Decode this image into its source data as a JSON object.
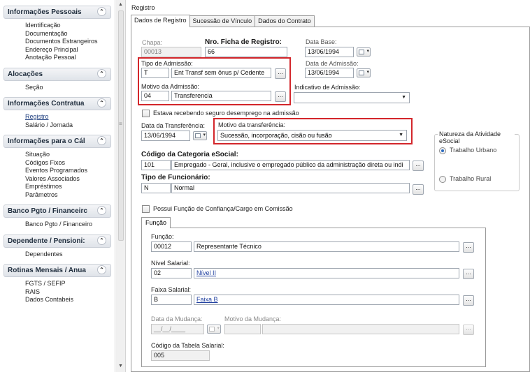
{
  "sidebar": {
    "sections": [
      {
        "title": "Informações Pessoais",
        "items": [
          "Identificação",
          "Documentação",
          "Documentos Estrangeiros",
          "Endereço Principal",
          "Anotação Pessoal"
        ]
      },
      {
        "title": "Alocações",
        "items": [
          "Seção"
        ]
      },
      {
        "title": "Informações Contratua",
        "items": [
          "Registro",
          "Salário / Jornada"
        ]
      },
      {
        "title": "Informações para o Cál",
        "items": [
          "Situação",
          "Códigos Fixos",
          "Eventos Programados",
          "Valores Associados",
          "Empréstimos",
          "Parâmetros"
        ]
      },
      {
        "title": "Banco Pgto / Financeirc",
        "items": [
          "Banco Pgto / Financeiro"
        ]
      },
      {
        "title": "Dependente / Pensioni:",
        "items": [
          "Dependentes"
        ]
      },
      {
        "title": "Rotinas Mensais / Anua",
        "items": [
          "FGTS / SEFIP",
          "RAIS",
          "Dados Contabeis"
        ]
      }
    ]
  },
  "main": {
    "title": "Registro",
    "tabs": [
      "Dados de Registro",
      "Sucessão de Vínculo",
      "Dados do Contrato"
    ],
    "chapa": {
      "label": "Chapa:",
      "value": "00013"
    },
    "ficha": {
      "label": "Nro. Ficha de Registro:",
      "value": "66"
    },
    "data_base": {
      "label": "Data Base:",
      "value": "13/06/1994"
    },
    "tipo_admissao": {
      "label": "Tipo de Admissão:",
      "code": "T",
      "desc": "Ent Transf sem ônus p/ Cedente"
    },
    "data_admissao": {
      "label": "Data de Admissão:",
      "value": "13/06/1994"
    },
    "motivo_admissao": {
      "label": "Motivo da Admissão:",
      "code": "04",
      "desc": "Transferencia"
    },
    "indicativo_admissao": {
      "label": "Indicativo de Admissão:",
      "value": ""
    },
    "seguro_desemprego": {
      "label": "Estava recebendo seguro desemprego na admissão"
    },
    "data_transferencia": {
      "label": "Data da Transferência:",
      "value": "13/06/1994"
    },
    "motivo_transferencia": {
      "label": "Motivo da transferência:",
      "value": "Sucessão, incorporação, cisão ou fusão"
    },
    "natureza": {
      "title": "Natureza da Atividade eSocial",
      "opt1": "Trabalho Urbano",
      "opt2": "Trabalho Rural"
    },
    "categoria": {
      "label": "Código da Categoria eSocial:",
      "code": "101",
      "desc": "Empregado - Geral, inclusive o empregado público da administração direta ou indi"
    },
    "tipo_funcionario": {
      "label": "Tipo de Funcionário:",
      "code": "N",
      "desc": "Normal"
    },
    "funcao_confianca": {
      "label": "Possui Função de Confiança/Cargo em Comissão"
    },
    "funcao_tab": "Função",
    "funcao": {
      "label": "Função:",
      "code": "00012",
      "desc": "Representante Técnico"
    },
    "nivel": {
      "label": "Nível Salarial:",
      "code": "02",
      "desc": "Nível II"
    },
    "faixa": {
      "label": "Faixa Salarial:",
      "code": "B",
      "desc": "Faixa B"
    },
    "data_mudanca": {
      "label": "Data da Mudança:",
      "value": "__/__/____"
    },
    "motivo_mudanca": {
      "label": "Motivo da Mudança:"
    },
    "tabela_salarial": {
      "label": "Código da Tabela Salarial:",
      "value": "005"
    }
  },
  "colors": {
    "highlight": "#d3262b",
    "link": "#1f3f9f"
  }
}
